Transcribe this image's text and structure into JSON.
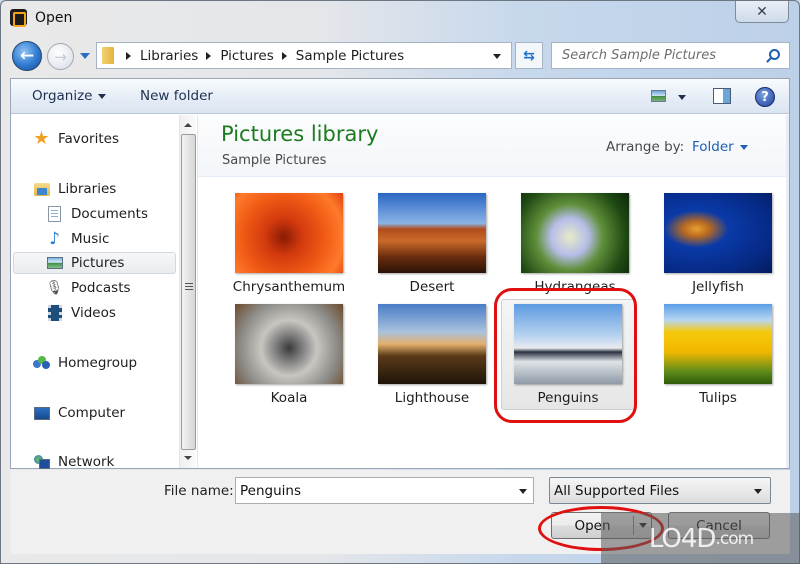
{
  "window": {
    "title": "Open",
    "close_symbol": "✕"
  },
  "nav": {
    "back_symbol": "←",
    "forward_symbol": "→",
    "breadcrumb": [
      "Libraries",
      "Pictures",
      "Sample Pictures"
    ],
    "refresh_symbol": "⇆",
    "search_placeholder": "Search Sample Pictures"
  },
  "toolbar": {
    "organize_label": "Organize",
    "new_folder_label": "New folder",
    "help_symbol": "?"
  },
  "sidebar": {
    "items": [
      {
        "label": "Favorites",
        "icon": "star-icon",
        "selected": false
      },
      {
        "label": "Libraries",
        "icon": "libraries-icon",
        "selected": false
      },
      {
        "label": "Documents",
        "icon": "documents-icon",
        "selected": false
      },
      {
        "label": "Music",
        "icon": "music-icon",
        "selected": false
      },
      {
        "label": "Pictures",
        "icon": "pictures-icon",
        "selected": true
      },
      {
        "label": "Podcasts",
        "icon": "podcasts-icon",
        "selected": false
      },
      {
        "label": "Videos",
        "icon": "videos-icon",
        "selected": false
      },
      {
        "label": "Homegroup",
        "icon": "homegroup-icon",
        "selected": false
      },
      {
        "label": "Computer",
        "icon": "computer-icon",
        "selected": false
      },
      {
        "label": "Network",
        "icon": "network-icon",
        "selected": false
      }
    ]
  },
  "content": {
    "title": "Pictures library",
    "subtitle": "Sample Pictures",
    "arrange_label": "Arrange by:",
    "arrange_value": "Folder",
    "files": [
      {
        "name": "Chrysanthemum",
        "selected": false
      },
      {
        "name": "Desert",
        "selected": false
      },
      {
        "name": "Hydrangeas",
        "selected": false
      },
      {
        "name": "Jellyfish",
        "selected": false
      },
      {
        "name": "Koala",
        "selected": false
      },
      {
        "name": "Lighthouse",
        "selected": false
      },
      {
        "name": "Penguins",
        "selected": true
      },
      {
        "name": "Tulips",
        "selected": false
      }
    ]
  },
  "footer": {
    "file_name_label": "File name:",
    "file_name_value": "Penguins",
    "file_type_value": "All Supported Files",
    "open_label": "Open",
    "cancel_label": "Cancel"
  },
  "watermark": {
    "text": "LO4D",
    "suffix": ".com"
  },
  "colors": {
    "title_green": "#1e7a1e",
    "link_blue": "#1f5eb0",
    "annotation_red": "#e01010"
  }
}
